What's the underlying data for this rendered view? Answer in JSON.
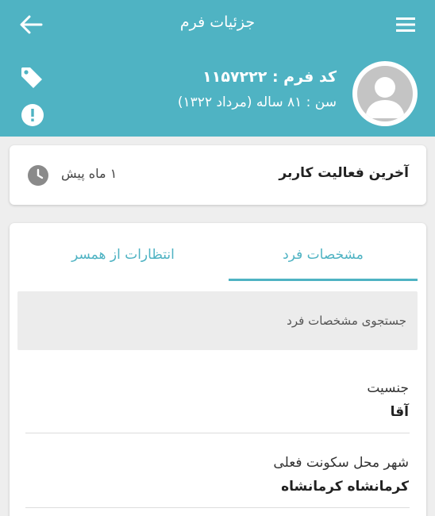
{
  "appbar": {
    "title": "جزئیات فرم",
    "back_icon": "arrow-left-icon",
    "menu_icon": "hamburger-menu-icon",
    "color": "#4fb3c3"
  },
  "profile": {
    "form_code": "کد فرم : ۱۱۵۷۲۲۲",
    "age": "سن : ۸۱ ساله (مرداد ۱۳۲۲)",
    "avatar_icon": "user-avatar-icon",
    "tag_icon": "tag-icon",
    "alert_icon": "alert-icon"
  },
  "activity": {
    "label": "آخرین فعالیت کاربر",
    "value": "۱ ماه پیش",
    "icon": "clock-icon"
  },
  "tabs": [
    {
      "label": "مشخصات فرد",
      "active": true
    },
    {
      "label": "انتظارات از همسر",
      "active": false
    }
  ],
  "search": {
    "placeholder": "جستجوی مشخصات فرد"
  },
  "fields": [
    {
      "label": "جنسیت",
      "value": "آقا"
    },
    {
      "label": "شهر محل سکونت فعلی",
      "value": "کرمانشاه کرمانشاه"
    }
  ]
}
